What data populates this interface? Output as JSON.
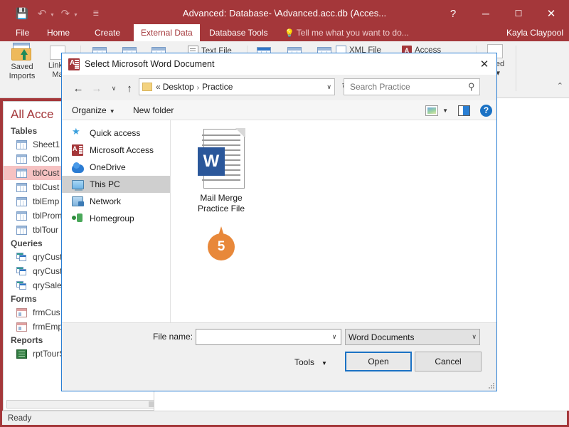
{
  "colors": {
    "access_accent": "#a4373a",
    "dialog_border": "#2a7fd4",
    "callout": "#e8883a",
    "word_blue": "#2b579a",
    "selection_pink": "#f6c2c2"
  },
  "window": {
    "title": "Advanced: Database- \\Advanced.acc.db (Acces...",
    "quick_access": [
      {
        "name": "save-icon",
        "glyph": "💾"
      },
      {
        "name": "undo-icon",
        "glyph": "↶"
      },
      {
        "name": "redo-icon",
        "glyph": "↷"
      },
      {
        "name": "customize-qat-icon",
        "glyph": "☰"
      }
    ],
    "controls": {
      "help": "?",
      "minimize": "─",
      "maximize": "☐",
      "close": "✕"
    }
  },
  "ribbon": {
    "tabs": [
      {
        "label": "File",
        "active": false
      },
      {
        "label": "Home",
        "active": false
      },
      {
        "label": "Create",
        "active": false
      },
      {
        "label": "External Data",
        "active": true
      },
      {
        "label": "Database Tools",
        "active": false
      }
    ],
    "tell_me": "Tell me what you want to do...",
    "user": "Kayla Claypool",
    "buttons": {
      "saved_imports_line1": "Saved",
      "saved_imports_line2": "Imports",
      "linked_table_line1": "Linke",
      "linked_table_line2": "Ma",
      "text_file": "Text File",
      "xml_file": "XML File",
      "access": "Access",
      "linked_line1": "inked",
      "linked_line2": "s "
    },
    "collapse": "⌃"
  },
  "nav_pane": {
    "header": "All Acce",
    "groups": [
      {
        "label": "Tables",
        "items": [
          {
            "label": "Sheet1",
            "type": "table",
            "selected": false
          },
          {
            "label": "tblCom",
            "type": "table",
            "selected": false
          },
          {
            "label": "tblCust",
            "type": "table",
            "selected": true
          },
          {
            "label": "tblCust",
            "type": "table",
            "selected": false
          },
          {
            "label": "tblEmp",
            "type": "table",
            "selected": false
          },
          {
            "label": "tblProm",
            "type": "table",
            "selected": false
          },
          {
            "label": "tblTour",
            "type": "table",
            "selected": false
          }
        ]
      },
      {
        "label": "Queries",
        "items": [
          {
            "label": "qryCust",
            "type": "query",
            "selected": false
          },
          {
            "label": "qryCust",
            "type": "query",
            "selected": false
          },
          {
            "label": "qrySale",
            "type": "query",
            "selected": false
          }
        ]
      },
      {
        "label": "Forms",
        "items": [
          {
            "label": "frmCus",
            "type": "form",
            "selected": false
          },
          {
            "label": "frmEmp",
            "type": "form",
            "selected": false
          }
        ]
      },
      {
        "label": "Reports",
        "items": [
          {
            "label": "rptTourSales",
            "type": "report",
            "selected": false
          }
        ]
      }
    ]
  },
  "status_bar": {
    "text": "Ready"
  },
  "dialog": {
    "title": "Select Microsoft Word Document",
    "close_glyph": "✕",
    "nav": {
      "back_glyph": "←",
      "forward_glyph": "→",
      "recent_glyph": "∨",
      "up_glyph": "↑",
      "refresh_glyph": "↻",
      "breadcrumb_prefix": "«",
      "breadcrumbs": [
        "Desktop",
        "Practice"
      ],
      "breadcrumb_separator": "›",
      "dropdown_glyph": "∨"
    },
    "search": {
      "placeholder": "Search Practice",
      "value": "",
      "icon": "⚲"
    },
    "toolbar": {
      "organize": "Organize",
      "organize_caret": "▼",
      "new_folder": "New folder",
      "view_caret": "▼",
      "help_glyph": "?"
    },
    "sidebar": [
      {
        "label": "Quick access",
        "icon": "pin-icon",
        "selected": false
      },
      {
        "label": "Microsoft Access",
        "icon": "access-icon",
        "selected": false
      },
      {
        "label": "OneDrive",
        "icon": "cloud-icon",
        "selected": false
      },
      {
        "label": "This PC",
        "icon": "computer-icon",
        "selected": true
      },
      {
        "label": "Network",
        "icon": "network-icon",
        "selected": false
      },
      {
        "label": "Homegroup",
        "icon": "homegroup-icon",
        "selected": false
      }
    ],
    "files": [
      {
        "name_line1": "Mail Merge",
        "name_line2": "Practice File",
        "icon": "word-document-icon",
        "icon_letter": "W"
      }
    ],
    "callout": {
      "number": "5"
    },
    "footer": {
      "file_name_label": "File name:",
      "file_name_value": "",
      "file_name_placeholder": "",
      "file_type_value": "Word Documents",
      "file_type_caret": "∨",
      "tools_label": "Tools",
      "tools_caret": "▼",
      "open_label": "Open",
      "cancel_label": "Cancel"
    }
  }
}
